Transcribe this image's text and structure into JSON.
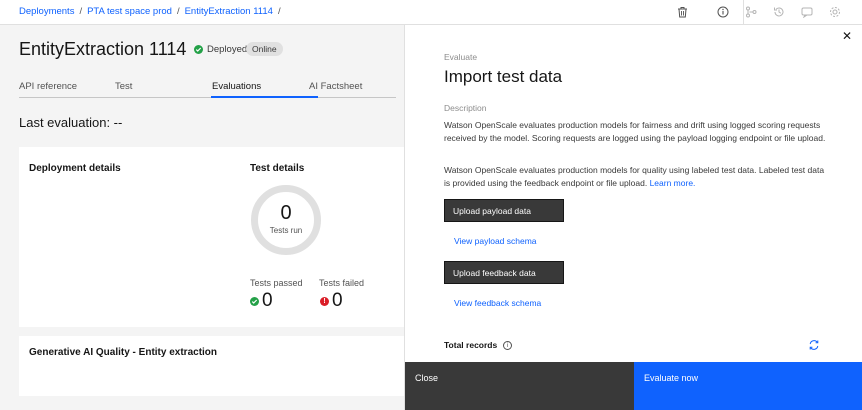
{
  "breadcrumb": [
    "Deployments",
    "PTA test space prod",
    "EntityExtraction 1114"
  ],
  "breadcrumb_sep": "/",
  "header": {
    "title": "EntityExtraction 1114",
    "status": "Deployed",
    "badge": "Online"
  },
  "tabs": [
    "API reference",
    "Test",
    "Evaluations",
    "AI Factsheet"
  ],
  "active_tab": "Evaluations",
  "last_evaluation": "Last evaluation: --",
  "deployment_details": {
    "title": "Deployment details"
  },
  "test_details": {
    "title": "Test details",
    "tests_run": "0",
    "tests_run_label": "Tests run",
    "passed_label": "Tests passed",
    "passed_value": "0",
    "failed_label": "Tests failed",
    "failed_value": "0"
  },
  "quality_card": {
    "title": "Generative AI Quality - Entity extraction"
  },
  "panel": {
    "eyebrow": "Evaluate",
    "title": "Import test data",
    "description_label": "Description",
    "para1": "Watson OpenScale evaluates production models for fairness and drift using logged scoring requests received by the model. Scoring requests are logged using the payload logging endpoint or file upload.",
    "para2": "Watson OpenScale evaluates production models for quality using labeled test data. Labeled test data is provided using the feedback endpoint or file upload.",
    "learn_more": "Learn more.",
    "upload_payload": "Upload payload data",
    "view_payload_schema": "View payload schema",
    "upload_feedback": "Upload feedback data",
    "view_feedback_schema": "View feedback schema",
    "total_records": "Total records",
    "close": "Close",
    "evaluate_now": "Evaluate now"
  },
  "colors": {
    "primary": "#0f62fe",
    "success": "#24a148",
    "error": "#da1e28",
    "dark_button": "#393939"
  },
  "icons": [
    "trash-icon",
    "info-icon",
    "flow-icon",
    "history-icon",
    "chat-icon",
    "settings-icon",
    "close-icon",
    "refresh-icon"
  ]
}
